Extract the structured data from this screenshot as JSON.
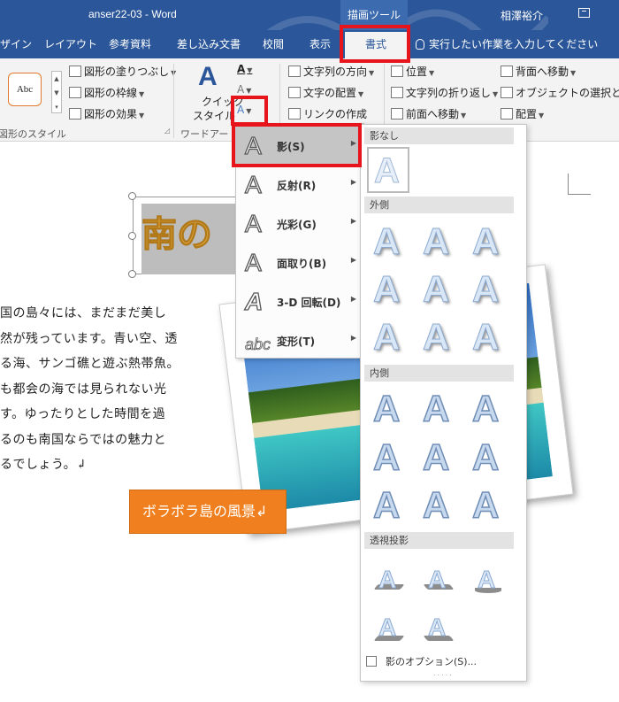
{
  "titlebar": {
    "doc_title": "anser22-03  -  Word",
    "tool_title": "描画ツール",
    "user": "相澤裕介"
  },
  "tabs": [
    {
      "label": "デザイン"
    },
    {
      "label": "レイアウト"
    },
    {
      "label": "参考資料"
    },
    {
      "label": "差し込み文書"
    },
    {
      "label": "校閲"
    },
    {
      "label": "表示"
    },
    {
      "label": "書式"
    }
  ],
  "tell_me": "実行したい作業を入力してください",
  "ribbon": {
    "shape_styles": {
      "sample": "Abc",
      "fill": "図形の塗りつぶし",
      "outline": "図形の枠線",
      "effects": "図形の効果",
      "group_label": "図形のスタイル"
    },
    "wordart": {
      "quick_style_1": "クイック",
      "quick_style_2": "スタイル",
      "glyph": "A",
      "group_label": "ワードアート"
    },
    "text": {
      "direction": "文字列の方向",
      "align": "文字の配置",
      "link": "リンクの作成"
    },
    "arrange": {
      "position": "位置",
      "wrap": "文字列の折り返し",
      "forward": "前面へ移動",
      "back": "背面へ移動",
      "select": "オブジェクトの選択と表示",
      "align": "配置"
    }
  },
  "document": {
    "title_text": "南の",
    "body_lines": [
      "国の島々には、まだまだ美し",
      "然が残っています。青い空、透",
      "る海、サンゴ礁と遊ぶ熱帯魚。",
      "も都会の海では見られない光",
      "す。ゆったりとした時間を過",
      "るのも南国ならではの魅力と",
      "るでしょう。↲"
    ],
    "caption": "ボラボラ島の風景↲"
  },
  "menu": {
    "items": [
      {
        "label": "影(S)",
        "glyph": "A"
      },
      {
        "label": "反射(R)",
        "glyph": "A"
      },
      {
        "label": "光彩(G)",
        "glyph": "A"
      },
      {
        "label": "面取り(B)",
        "glyph": "A"
      },
      {
        "label": "3-D 回転(D)",
        "glyph": "A"
      },
      {
        "label": "変形(T)",
        "glyph": "abc"
      }
    ]
  },
  "shadow_gallery": {
    "glyph": "A",
    "sections": {
      "none": "影なし",
      "outer": "外側",
      "inner": "内側",
      "perspective": "透視投影"
    },
    "option": "影のオプション(S)...",
    "dots": "....."
  }
}
